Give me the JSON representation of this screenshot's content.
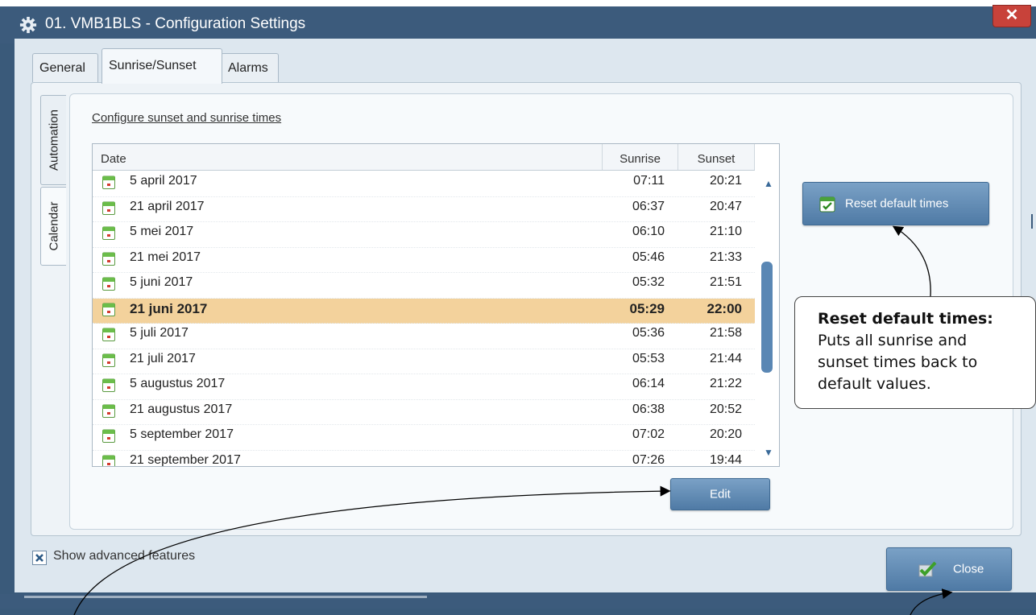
{
  "window": {
    "title": "01. VMB1BLS - Configuration Settings",
    "close_glyph": "✕"
  },
  "tabs": [
    {
      "label": "General",
      "active": false
    },
    {
      "label": "Sunrise/Sunset",
      "active": true
    },
    {
      "label": "Alarms",
      "active": false
    }
  ],
  "side_tabs": [
    {
      "label": "Automation",
      "active": false
    },
    {
      "label": "Calendar",
      "active": true
    }
  ],
  "section_title": "Configure sunset and sunrise times",
  "table": {
    "columns": [
      "Date",
      "Sunrise",
      "Sunset"
    ],
    "rows": [
      {
        "date": "5 april 2017",
        "sunrise": "07:11",
        "sunset": "20:21",
        "selected": false
      },
      {
        "date": "21 april 2017",
        "sunrise": "06:37",
        "sunset": "20:47",
        "selected": false
      },
      {
        "date": "5 mei 2017",
        "sunrise": "06:10",
        "sunset": "21:10",
        "selected": false
      },
      {
        "date": "21 mei 2017",
        "sunrise": "05:46",
        "sunset": "21:33",
        "selected": false
      },
      {
        "date": "5 juni 2017",
        "sunrise": "05:32",
        "sunset": "21:51",
        "selected": false
      },
      {
        "date": "21 juni 2017",
        "sunrise": "05:29",
        "sunset": "22:00",
        "selected": true
      },
      {
        "date": "5 juli 2017",
        "sunrise": "05:36",
        "sunset": "21:58",
        "selected": false
      },
      {
        "date": "21 juli 2017",
        "sunrise": "05:53",
        "sunset": "21:44",
        "selected": false
      },
      {
        "date": "5 augustus 2017",
        "sunrise": "06:14",
        "sunset": "21:22",
        "selected": false
      },
      {
        "date": "21 augustus 2017",
        "sunrise": "06:38",
        "sunset": "20:52",
        "selected": false
      },
      {
        "date": "5 september 2017",
        "sunrise": "07:02",
        "sunset": "20:20",
        "selected": false
      },
      {
        "date": "21 september 2017",
        "sunrise": "07:26",
        "sunset": "19:44",
        "selected": false
      }
    ]
  },
  "buttons": {
    "reset_label": "Reset default times",
    "edit_label": "Edit",
    "close_label": "Close"
  },
  "advanced": {
    "label": "Show advanced features",
    "checked": true
  },
  "callout": {
    "title": "Reset default times:",
    "lines": [
      "Puts all sunrise and",
      "sunset times back to",
      "default values."
    ]
  },
  "icons": {
    "title": "gear-icon",
    "row": "calendar-icon",
    "reset": "calendar-check-icon",
    "close": "checkmark-icon",
    "scroll_up": "arrow-up-icon",
    "scroll_down": "arrow-down-icon"
  },
  "colors": {
    "titlebar": "#3c5b7c",
    "button": "#5c86b0",
    "selected_row": "#f3d29c",
    "close_x": "#c8423a"
  }
}
